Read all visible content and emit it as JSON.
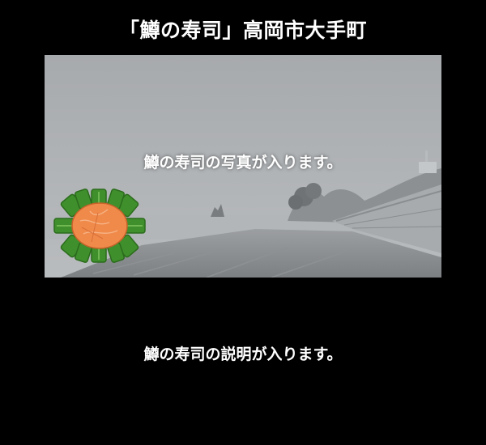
{
  "header": {
    "title": "「鱒の寿司」高岡市大手町"
  },
  "photo": {
    "caption_highlight": "鱒の寿司",
    "caption_rest": "の写真が入ります。"
  },
  "description": {
    "highlight": "鱒の寿司",
    "rest": "の説明が入ります。"
  },
  "colors": {
    "background": "#000000",
    "accent_highlight": "#4aa3df",
    "bamboo_leaf": "#3f8f2c",
    "trout_flesh": "#f08a4a"
  },
  "icons": {
    "sushi": "masu-sushi-icon"
  }
}
